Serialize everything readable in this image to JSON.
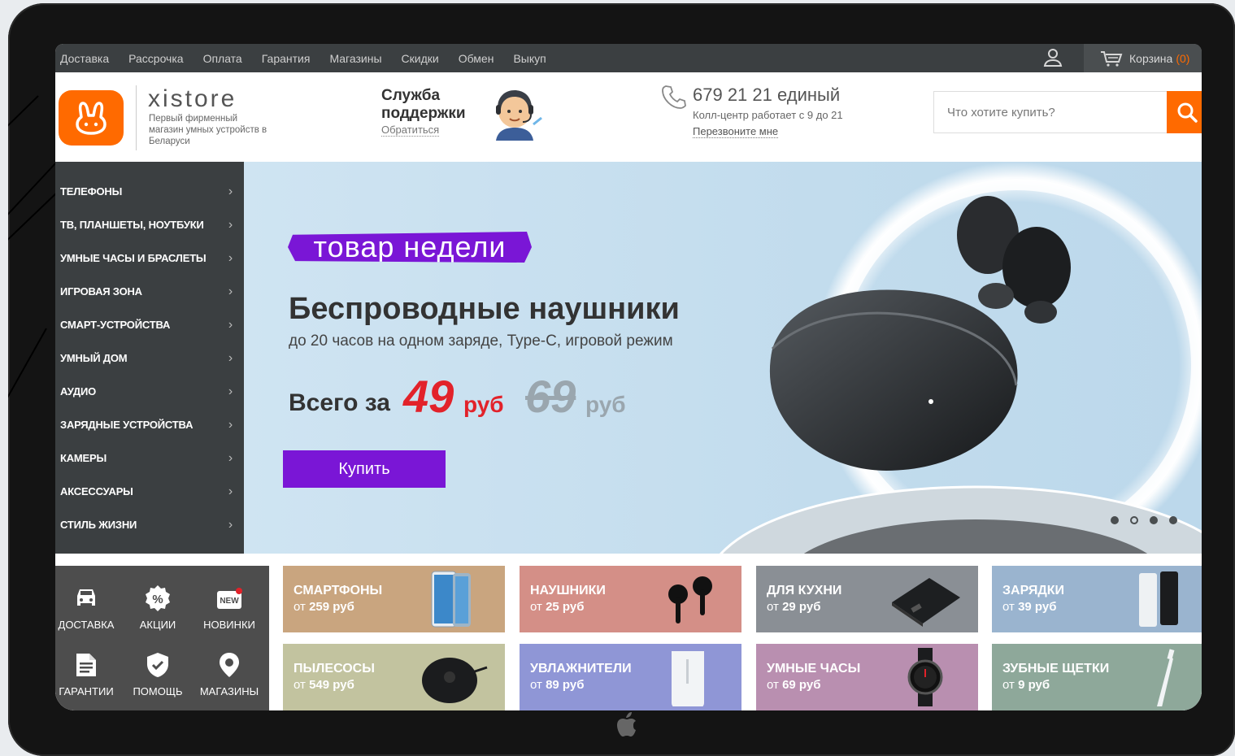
{
  "topnav": {
    "links": [
      "Доставка",
      "Рассрочка",
      "Оплата",
      "Гарантия",
      "Магазины",
      "Скидки",
      "Обмен",
      "Выкуп"
    ],
    "cart_label": "Корзина",
    "cart_count": "(0)"
  },
  "header": {
    "brand": "xistore",
    "brand_sub": "Первый фирменный магазин умных устройств в Беларуси",
    "support_title": "Служба поддержки",
    "support_link": "Обратиться",
    "phone": "679 21 21 единый",
    "hours": "Колл-центр работает с 9 до 21",
    "callback": "Перезвоните мне",
    "search_placeholder": "Что хотите купить?"
  },
  "sidebar": {
    "items": [
      {
        "label": "ТЕЛЕФОНЫ"
      },
      {
        "label": "ТВ, ПЛАНШЕТЫ, НОУТБУКИ"
      },
      {
        "label": "УМНЫЕ ЧАСЫ И БРАСЛЕТЫ"
      },
      {
        "label": "ИГРОВАЯ ЗОНА"
      },
      {
        "label": "СМАРТ-УСТРОЙСТВА"
      },
      {
        "label": "УМНЫЙ ДОМ"
      },
      {
        "label": "АУДИО"
      },
      {
        "label": "ЗАРЯДНЫЕ УСТРОЙСТВА"
      },
      {
        "label": "КАМЕРЫ"
      },
      {
        "label": "АКСЕССУАРЫ"
      },
      {
        "label": "СТИЛЬ ЖИЗНИ"
      }
    ]
  },
  "banner": {
    "badge": "товар недели",
    "title": "Беспроводные наушники",
    "subtitle": "до 20 часов на одном заряде, Type-C, игровой режим",
    "price_label": "Всего за",
    "price_new": "49",
    "price_old": "69",
    "currency": "руб",
    "buy_label": "Купить",
    "slides": 4,
    "active_slide": 1
  },
  "quick": [
    {
      "label": "ДОСТАВКА",
      "icon": "car-icon"
    },
    {
      "label": "АКЦИИ",
      "icon": "percent-icon"
    },
    {
      "label": "НОВИНКИ",
      "icon": "new-badge-icon"
    },
    {
      "label": "ГАРАНТИИ",
      "icon": "document-icon"
    },
    {
      "label": "ПОМОЩЬ",
      "icon": "shield-check-icon"
    },
    {
      "label": "МАГАЗИНЫ",
      "icon": "location-pin-icon"
    }
  ],
  "categories": [
    {
      "name": "СМАРТФОНЫ",
      "from": "от",
      "price": "259 руб",
      "color": "#c9a57f",
      "icon": "smartphone-icon"
    },
    {
      "name": "НАУШНИКИ",
      "from": "от",
      "price": "25 руб",
      "color": "#d48f87",
      "icon": "earbuds-icon"
    },
    {
      "name": "ДЛЯ КУХНИ",
      "from": "от",
      "price": "29 руб",
      "color": "#8a8f95",
      "icon": "kitchen-scale-icon"
    },
    {
      "name": "ЗАРЯДКИ",
      "from": "от",
      "price": "39 руб",
      "color": "#9ab4cf",
      "icon": "powerbank-icon"
    },
    {
      "name": "ПЫЛЕСОСЫ",
      "from": "от",
      "price": "549 руб",
      "color": "#c2c39f",
      "icon": "robot-vacuum-icon"
    },
    {
      "name": "УВЛАЖНИТЕЛИ",
      "from": "от",
      "price": "89 руб",
      "color": "#8f96d6",
      "icon": "humidifier-icon"
    },
    {
      "name": "УМНЫЕ ЧАСЫ",
      "from": "от",
      "price": "69 руб",
      "color": "#b98fb0",
      "icon": "smartwatch-icon"
    },
    {
      "name": "ЗУБНЫЕ ЩЕТКИ",
      "from": "от",
      "price": "9 руб",
      "color": "#8ea89a",
      "icon": "toothbrush-icon"
    }
  ],
  "colors": {
    "accent": "#ff6a00",
    "purple": "#7a16d6",
    "red": "#e2222a",
    "dark": "#3b3f41"
  }
}
